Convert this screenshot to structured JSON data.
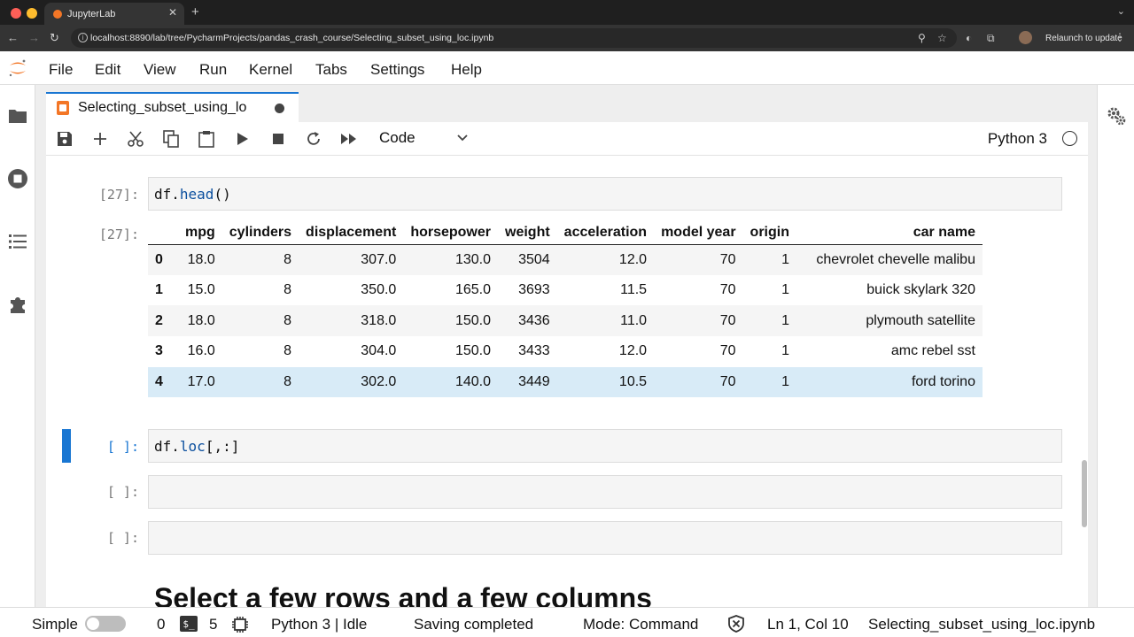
{
  "browser": {
    "tab_title": "JupyterLab",
    "tab_close": "✕",
    "new_tab": "+",
    "url": "localhost:8890/lab/tree/PycharmProjects/pandas_crash_course/Selecting_subset_using_loc.ipynb",
    "relaunch_label": "Relaunch to update",
    "traffic_colors": [
      "#ff5f57",
      "#febc2e",
      "#28c840"
    ]
  },
  "menu": [
    "File",
    "Edit",
    "View",
    "Run",
    "Kernel",
    "Tabs",
    "Settings",
    "Help"
  ],
  "document_tab": {
    "title": "Selecting_subset_using_lo"
  },
  "toolbar": {
    "cell_type": "Code",
    "kernel": "Python 3"
  },
  "cells": {
    "cell1": {
      "prompt": "[27]:",
      "code_obj": "df.",
      "code_fn": "head",
      "code_rest": "()"
    },
    "out1": {
      "prompt": "[27]:"
    },
    "cell2": {
      "prompt": "[ ]:",
      "code_obj": "df.",
      "code_fn": "loc",
      "code_rest": "[,:]"
    },
    "cell3": {
      "prompt": "[ ]:"
    },
    "cell4": {
      "prompt": "[ ]:"
    },
    "markdown_heading": "Select a few rows and a few columns"
  },
  "dataframe": {
    "columns": [
      "mpg",
      "cylinders",
      "displacement",
      "horsepower",
      "weight",
      "acceleration",
      "model year",
      "origin",
      "car name"
    ],
    "rows": [
      [
        "0",
        "18.0",
        "8",
        "307.0",
        "130.0",
        "3504",
        "12.0",
        "70",
        "1",
        "chevrolet chevelle malibu"
      ],
      [
        "1",
        "15.0",
        "8",
        "350.0",
        "165.0",
        "3693",
        "11.5",
        "70",
        "1",
        "buick skylark 320"
      ],
      [
        "2",
        "18.0",
        "8",
        "318.0",
        "150.0",
        "3436",
        "11.0",
        "70",
        "1",
        "plymouth satellite"
      ],
      [
        "3",
        "16.0",
        "8",
        "304.0",
        "150.0",
        "3433",
        "12.0",
        "70",
        "1",
        "amc rebel sst"
      ],
      [
        "4",
        "17.0",
        "8",
        "302.0",
        "140.0",
        "3449",
        "10.5",
        "70",
        "1",
        "ford torino"
      ]
    ]
  },
  "statusbar": {
    "mode_label": "Simple",
    "terminals_count": "0",
    "terminal_glyph": "$_",
    "kernels_count": "5",
    "kernel_status": "Python 3 | Idle",
    "save_status": "Saving completed",
    "mode": "Mode: Command",
    "cursor": "Ln 1, Col 10",
    "filename": "Selecting_subset_using_loc.ipynb"
  },
  "colors": {
    "accent": "#1976d2",
    "jupyter_orange": "#f37626",
    "row_hover": "#d8ebf7"
  }
}
